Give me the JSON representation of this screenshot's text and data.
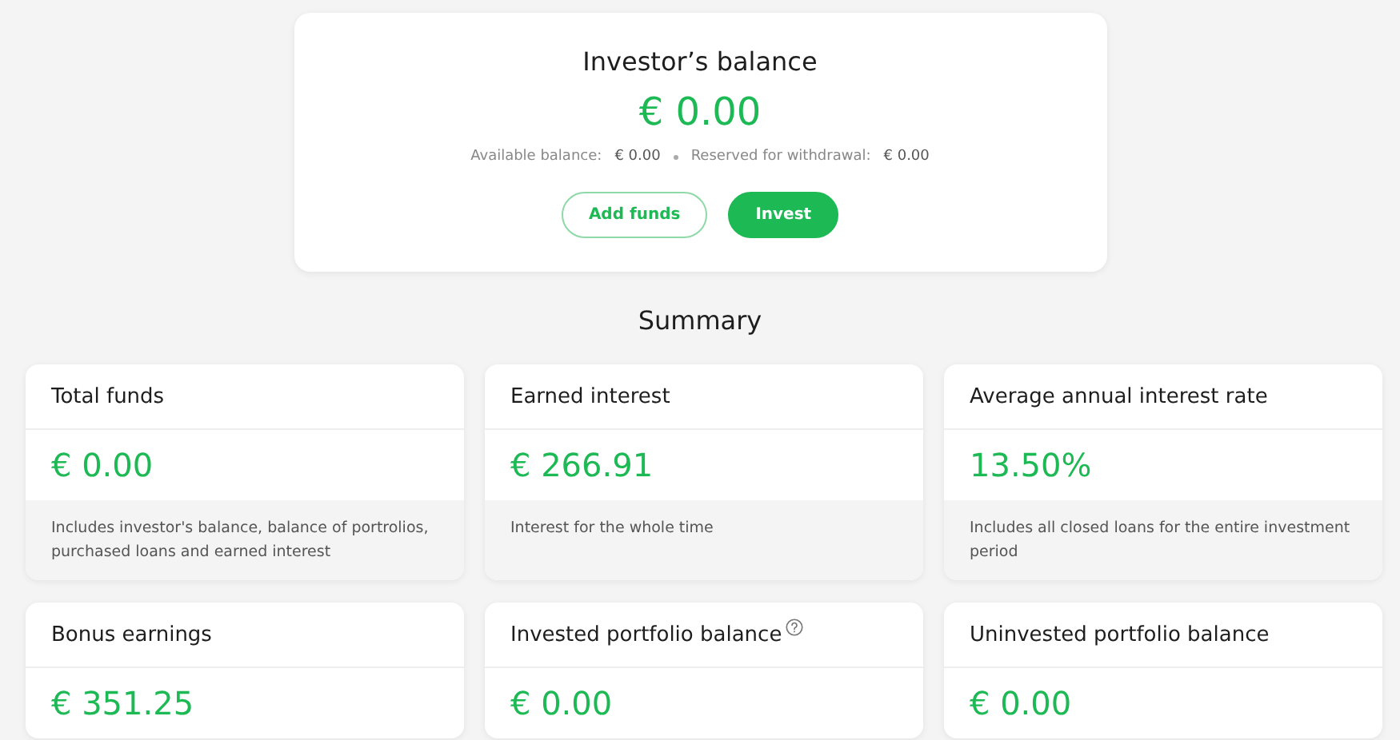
{
  "balance_card": {
    "title": "Investor’s balance",
    "amount": "€ 0.00",
    "details": [
      {
        "label": "Available balance:",
        "value": "€ 0.00"
      },
      {
        "label": "Reserved for withdrawal:",
        "value": "€ 0.00"
      }
    ],
    "buttons": [
      {
        "label": "Add funds",
        "kind": "outline"
      },
      {
        "label": "Invest",
        "kind": "primary"
      }
    ]
  },
  "summary": {
    "title": "Summary",
    "cards": [
      {
        "title": "Total funds",
        "value": "€ 0.00",
        "description": "Includes investor's balance, balance of portrolios, purchased loans and earned interest",
        "info_icon": false
      },
      {
        "title": "Earned interest",
        "value": "€ 266.91",
        "description": "Interest for the whole time",
        "info_icon": false
      },
      {
        "title": "Average annual interest rate",
        "value": "13.50%",
        "description": "Includes all closed loans for the entire investment period",
        "info_icon": false
      },
      {
        "title": "Bonus earnings",
        "value": "€ 351.25",
        "info_icon": false
      },
      {
        "title": "Invested portfolio balance",
        "value": "€ 0.00",
        "info_icon": true
      },
      {
        "title": "Uninvested portfolio balance",
        "value": "€ 0.00",
        "info_icon": false
      }
    ]
  }
}
